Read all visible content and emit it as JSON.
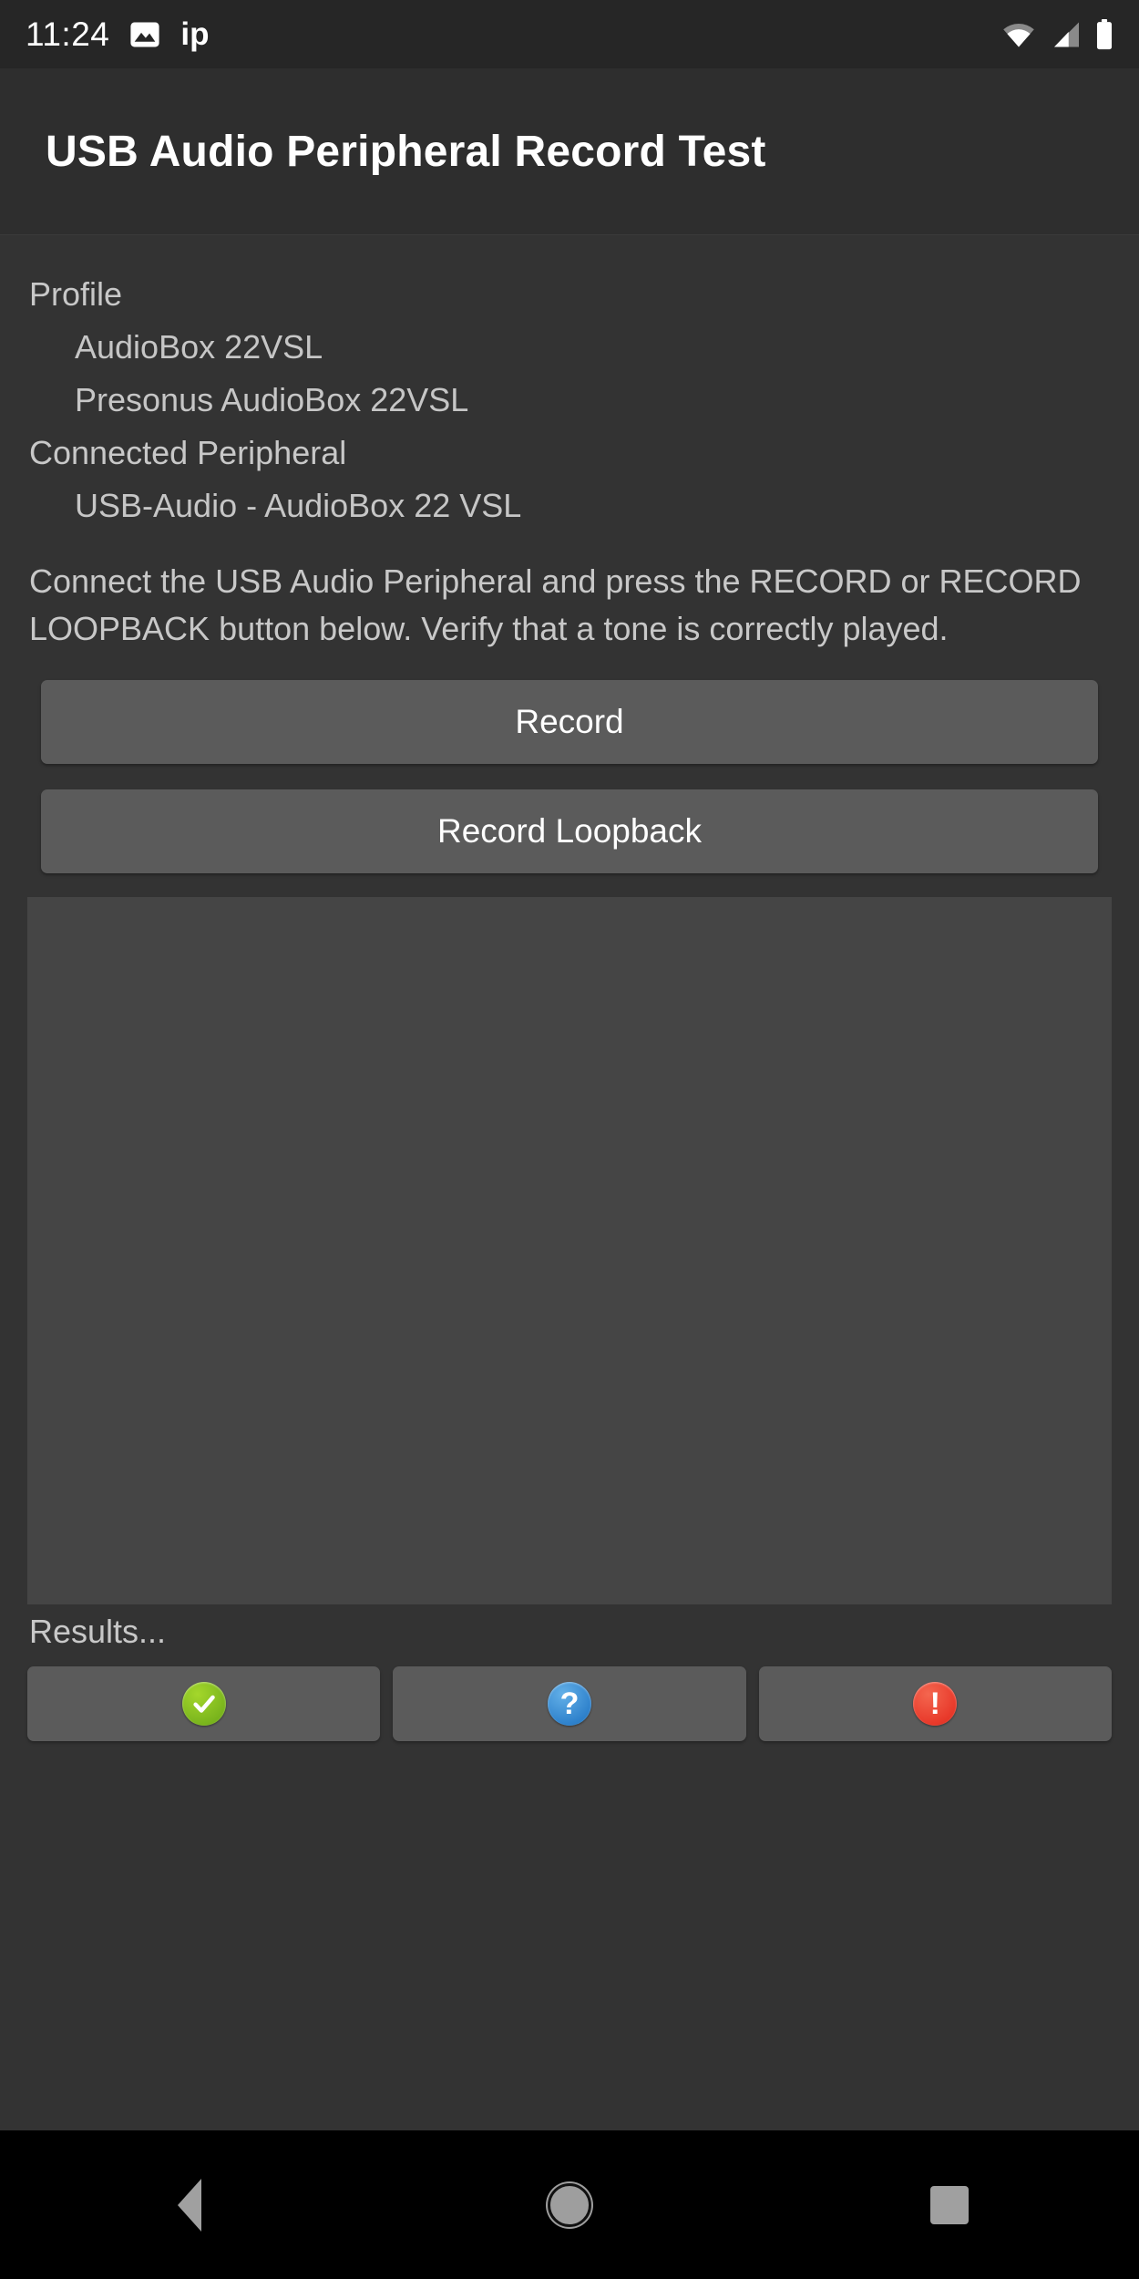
{
  "status_bar": {
    "clock": "11:24",
    "icons": [
      "image-icon",
      "ip-text-icon"
    ],
    "text_icon": "ip",
    "right_icons": [
      "wifi-icon",
      "cellular-signal-icon",
      "battery-icon"
    ]
  },
  "title_bar": {
    "title": "USB Audio Peripheral Record Test"
  },
  "info": {
    "profile_heading": "Profile",
    "profile_name": "AudioBox 22VSL",
    "profile_product": "Presonus AudioBox 22VSL",
    "connected_heading": "Connected Peripheral",
    "connected_device": "USB-Audio - AudioBox 22 VSL"
  },
  "instructions": "Connect the USB Audio Peripheral and press the RECORD or RECORD LOOPBACK button below. Verify that a tone is correctly played.",
  "buttons": {
    "record": "Record",
    "record_loopback": "Record Loopback"
  },
  "results_panel": {
    "text": ""
  },
  "results": {
    "label": "Results...",
    "pass_icon": "check-circle-icon",
    "info_icon": "question-circle-icon",
    "fail_icon": "exclamation-circle-icon"
  },
  "nav_bar": {
    "back": "back-icon",
    "home": "home-icon",
    "recents": "recents-icon"
  },
  "colors": {
    "background": "#333333",
    "title_bar": "#2e2e2e",
    "status_bar": "#262626",
    "button": "#5b5b5b",
    "panel": "#454545",
    "pass": "#7ab51d",
    "info": "#2f82cc",
    "fail": "#e8392a",
    "nav_bar": "#000000"
  }
}
